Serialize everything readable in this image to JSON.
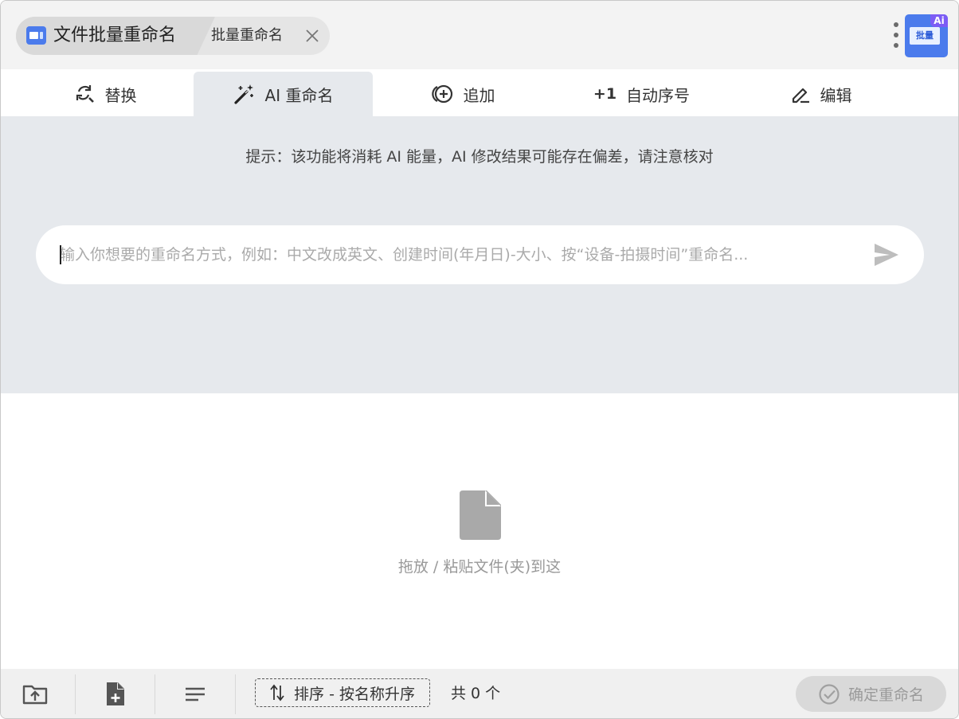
{
  "titlebar": {
    "app_name": "文件批量重命名",
    "tab_title": "批量重命名",
    "logo_text": "批量",
    "logo_badge": "Ai"
  },
  "tabs": [
    {
      "label": "替换",
      "icon": "refresh-search-icon"
    },
    {
      "label": "AI 重命名",
      "icon": "magic-wand-icon",
      "active": true
    },
    {
      "label": "追加",
      "icon": "add-circle-icon"
    },
    {
      "label": "自动序号",
      "icon": "plus-one-icon",
      "prefix": "+1"
    },
    {
      "label": "编辑",
      "icon": "pencil-icon"
    }
  ],
  "ai_panel": {
    "hint": "提示：该功能将消耗 AI 能量，AI 修改结果可能存在偏差，请注意核对",
    "prompt_value": "",
    "prompt_placeholder": "输入你想要的重命名方式，例如：中文改成英文、创建时间(年月日)-大小、按“设备-拍摄时间”重命名..."
  },
  "drop_zone": {
    "text": "拖放 / 粘贴文件(夹)到这"
  },
  "bottombar": {
    "sort_label": "排序 - 按名称升序",
    "count": "共 0 个",
    "confirm_label": "确定重命名"
  },
  "colors": {
    "accent": "#4b7bec",
    "badge": "#7c5cf5",
    "panel_bg": "#e6e9ed",
    "titlebar_bg": "#f3f3f3"
  }
}
